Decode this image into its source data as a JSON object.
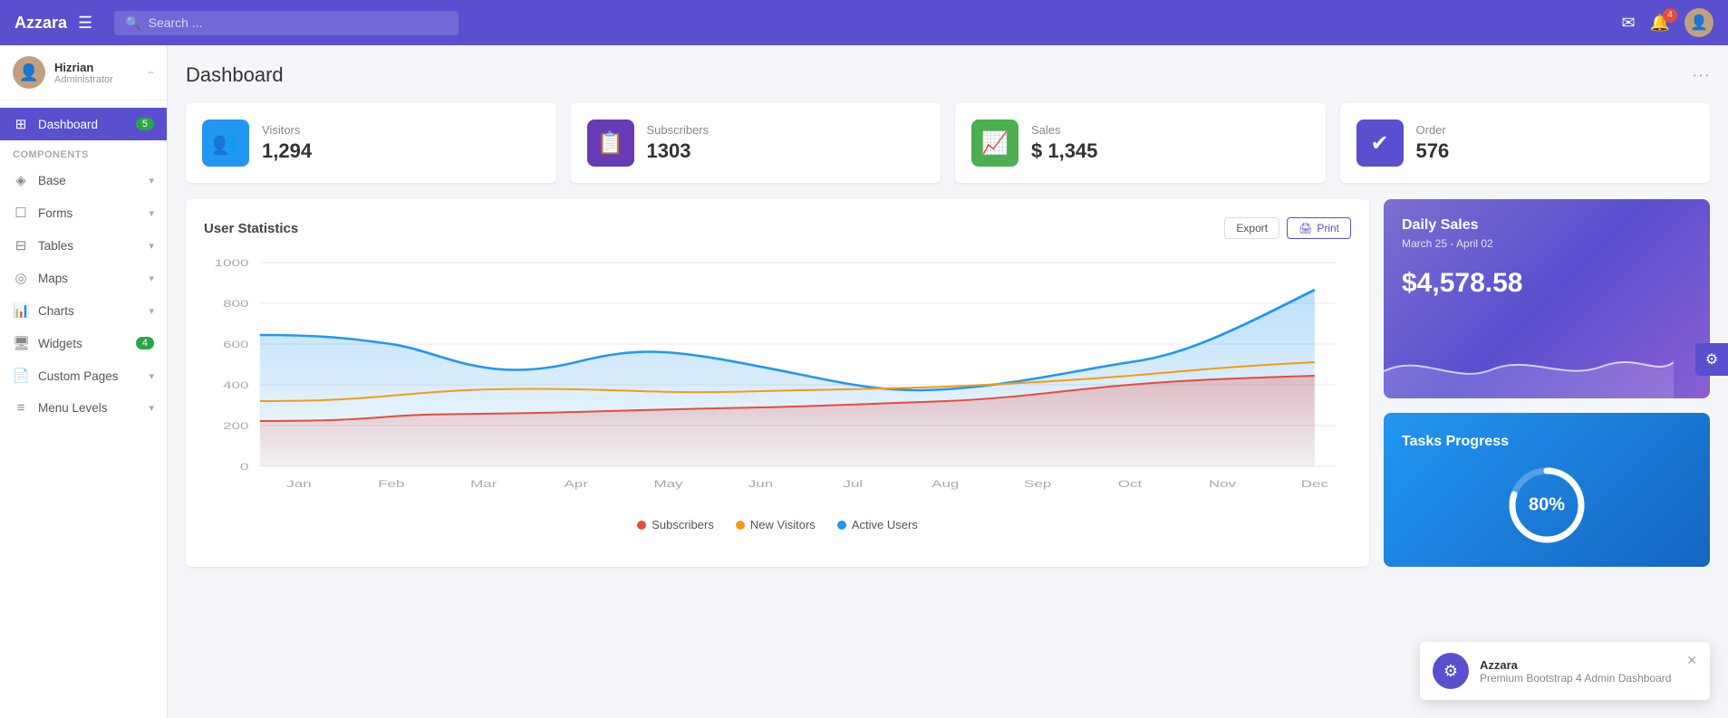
{
  "app": {
    "brand": "Azzara",
    "toggle_icon": "☰"
  },
  "navbar": {
    "search_placeholder": "Search ...",
    "notification_count": "4",
    "mail_icon": "✉",
    "bell_icon": "🔔",
    "avatar_icon": "👤"
  },
  "sidebar": {
    "user": {
      "name": "Hizrian",
      "role": "Administrator"
    },
    "nav_items": [
      {
        "label": "Dashboard",
        "icon": "⊞",
        "badge": "5",
        "active": true
      },
      {
        "label": "COMPONENTS",
        "type": "section"
      },
      {
        "label": "Base",
        "icon": "◈",
        "arrow": true
      },
      {
        "label": "Forms",
        "icon": "☐",
        "arrow": true
      },
      {
        "label": "Tables",
        "icon": "⊟",
        "arrow": true
      },
      {
        "label": "Maps",
        "icon": "◎",
        "arrow": true
      },
      {
        "label": "Charts",
        "icon": "📊",
        "arrow": true
      },
      {
        "label": "Widgets",
        "icon": "🖥",
        "badge_green": "4"
      },
      {
        "label": "Custom Pages",
        "icon": "📄",
        "arrow": true
      },
      {
        "label": "Menu Levels",
        "icon": "≡",
        "arrow": true
      }
    ]
  },
  "page": {
    "title": "Dashboard",
    "more_icon": "···"
  },
  "stats": [
    {
      "label": "Visitors",
      "value": "1,294",
      "icon": "👥",
      "icon_class": "blue"
    },
    {
      "label": "Subscribers",
      "value": "1303",
      "icon": "📋",
      "icon_class": "purple"
    },
    {
      "label": "Sales",
      "value": "$ 1,345",
      "icon": "📈",
      "icon_class": "green"
    },
    {
      "label": "Order",
      "value": "576",
      "icon": "✔",
      "icon_class": "indigo"
    }
  ],
  "chart": {
    "title": "User Statistics",
    "export_label": "Export",
    "print_label": "Print",
    "y_labels": [
      "1000",
      "800",
      "600",
      "400",
      "200",
      "0"
    ],
    "x_labels": [
      "Jan",
      "Feb",
      "Mar",
      "Apr",
      "May",
      "Jun",
      "Jul",
      "Aug",
      "Sep",
      "Oct",
      "Nov",
      "Dec"
    ],
    "legend": [
      {
        "label": "Subscribers",
        "color": "#e74c3c"
      },
      {
        "label": "New Visitors",
        "color": "#f39c12"
      },
      {
        "label": "Active Users",
        "color": "#2196f3"
      }
    ]
  },
  "daily_sales": {
    "title": "Daily Sales",
    "date_range": "March 25 - April 02",
    "amount": "$4,578.58"
  },
  "tasks_progress": {
    "title": "Tasks Progress",
    "percent": 80,
    "percent_label": "80%"
  },
  "toast": {
    "title": "Azzara",
    "subtitle": "Premium Bootstrap 4 Admin Dashboard",
    "close_icon": "✕"
  },
  "settings_icon": "⚙"
}
